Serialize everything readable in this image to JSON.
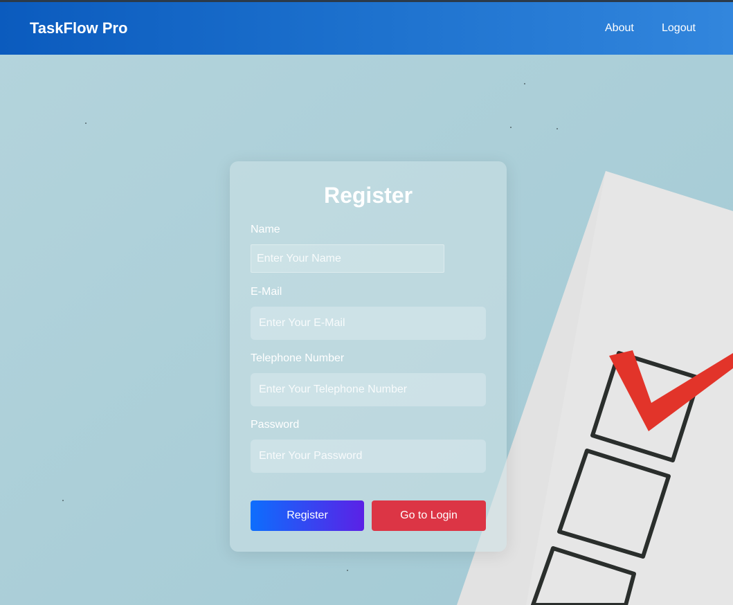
{
  "navbar": {
    "brand": "TaskFlow Pro",
    "links": [
      {
        "label": "About"
      },
      {
        "label": "Logout"
      }
    ]
  },
  "form": {
    "title": "Register",
    "fields": [
      {
        "label": "Name",
        "placeholder": "Enter Your Name",
        "value": ""
      },
      {
        "label": "E-Mail",
        "placeholder": "Enter Your E-Mail",
        "value": ""
      },
      {
        "label": "Telephone Number",
        "placeholder": "Enter Your Telephone Number",
        "value": ""
      },
      {
        "label": "Password",
        "placeholder": "Enter Your Password",
        "value": ""
      }
    ],
    "register_label": "Register",
    "login_label": "Go to Login"
  },
  "colors": {
    "navbar_start": "#0b5bbe",
    "navbar_end": "#3286dd",
    "register_start": "#0d6efd",
    "register_end": "#5b21e6",
    "login": "#dc3545",
    "check_mark": "#e2342a"
  },
  "background_image": "checklist-paper-with-red-checkmark"
}
